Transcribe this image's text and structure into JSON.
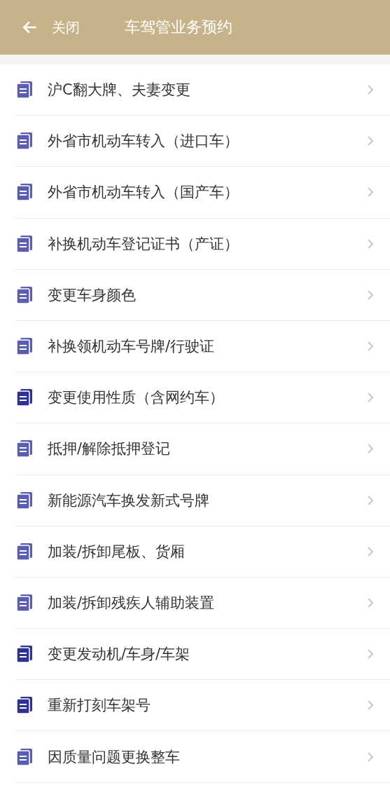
{
  "header": {
    "back_label": "关闭",
    "title": "车驾管业务预约"
  },
  "items": [
    {
      "label": "沪C翻大牌、夫妻变更",
      "color": "#5b5eb0"
    },
    {
      "label": "外省市机动车转入（进口车）",
      "color": "#5b5eb0"
    },
    {
      "label": "外省市机动车转入（国产车）",
      "color": "#5b5eb0"
    },
    {
      "label": "补换机动车登记证书（产证）",
      "color": "#5b5eb0"
    },
    {
      "label": "变更车身颜色",
      "color": "#5b5eb0"
    },
    {
      "label": "补换领机动车号牌/行驶证",
      "color": "#5b5eb0"
    },
    {
      "label": "变更使用性质（含网约车）",
      "color": "#2e3192"
    },
    {
      "label": "抵押/解除抵押登记",
      "color": "#5b5eb0"
    },
    {
      "label": "新能源汽车换发新式号牌",
      "color": "#5b5eb0"
    },
    {
      "label": "加装/拆卸尾板、货厢",
      "color": "#5b5eb0"
    },
    {
      "label": "加装/拆卸残疾人辅助装置",
      "color": "#5b5eb0"
    },
    {
      "label": "变更发动机/车身/车架",
      "color": "#2e3192"
    },
    {
      "label": "重新打刻车架号",
      "color": "#2e3192"
    },
    {
      "label": "因质量问题更换整车",
      "color": "#5b5eb0"
    }
  ]
}
